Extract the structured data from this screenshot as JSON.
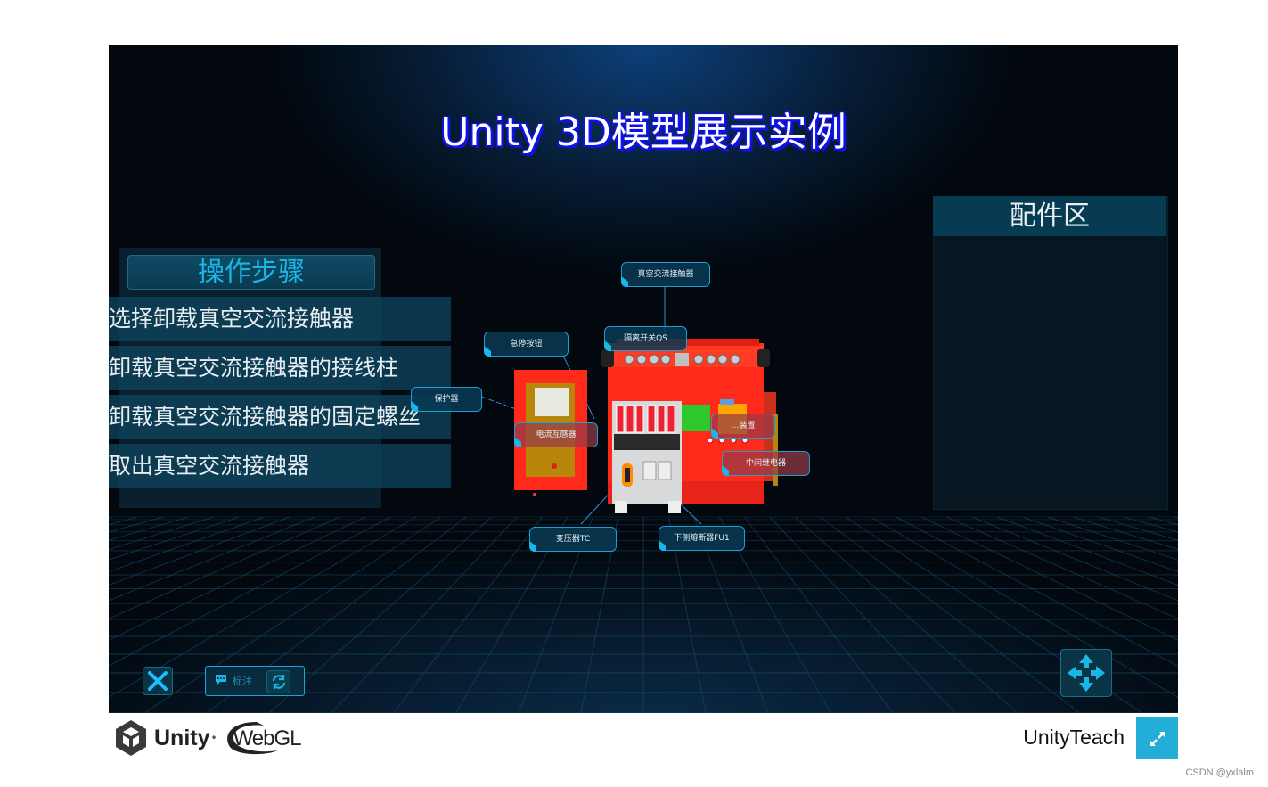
{
  "scene": {
    "title": "Unity 3D模型展示实例"
  },
  "steps_panel": {
    "header": "操作步骤",
    "steps": [
      {
        "label": "选择卸载真空交流接触器"
      },
      {
        "label": "卸载真空交流接触器的接线柱"
      },
      {
        "label": "卸载真空交流接触器的固定螺丝"
      },
      {
        "label": "取出真空交流接触器"
      }
    ]
  },
  "parts_panel": {
    "header": "配件区"
  },
  "model_callouts": [
    {
      "label": "真空交流接触器"
    },
    {
      "label": "急停按钮"
    },
    {
      "label": "隔离开关QS"
    },
    {
      "label": "保护器"
    },
    {
      "label": "电流互感器"
    },
    {
      "label": "…装置"
    },
    {
      "label": "中间继电器"
    },
    {
      "label": "变压器TC"
    },
    {
      "label": "下侧熔断器FU1"
    }
  ],
  "controls": {
    "close_icon": "close-icon",
    "annotate_label": "标注",
    "annotate_icon": "chat-bubble-icon",
    "reset_icon": "refresh-icon",
    "move_icon": "move-arrows-icon"
  },
  "footer": {
    "unity_label": "Unity",
    "webgl_label": "WebGL",
    "app_title": "UnityTeach",
    "fullscreen_icon": "fullscreen-icon",
    "watermark": "CSDN @yxlalm"
  },
  "colors": {
    "accent": "#1ab6e4",
    "title_shadow": "#1010e8",
    "model_red": "#ff2a1a",
    "fullscreen_bg": "#23aed8"
  }
}
